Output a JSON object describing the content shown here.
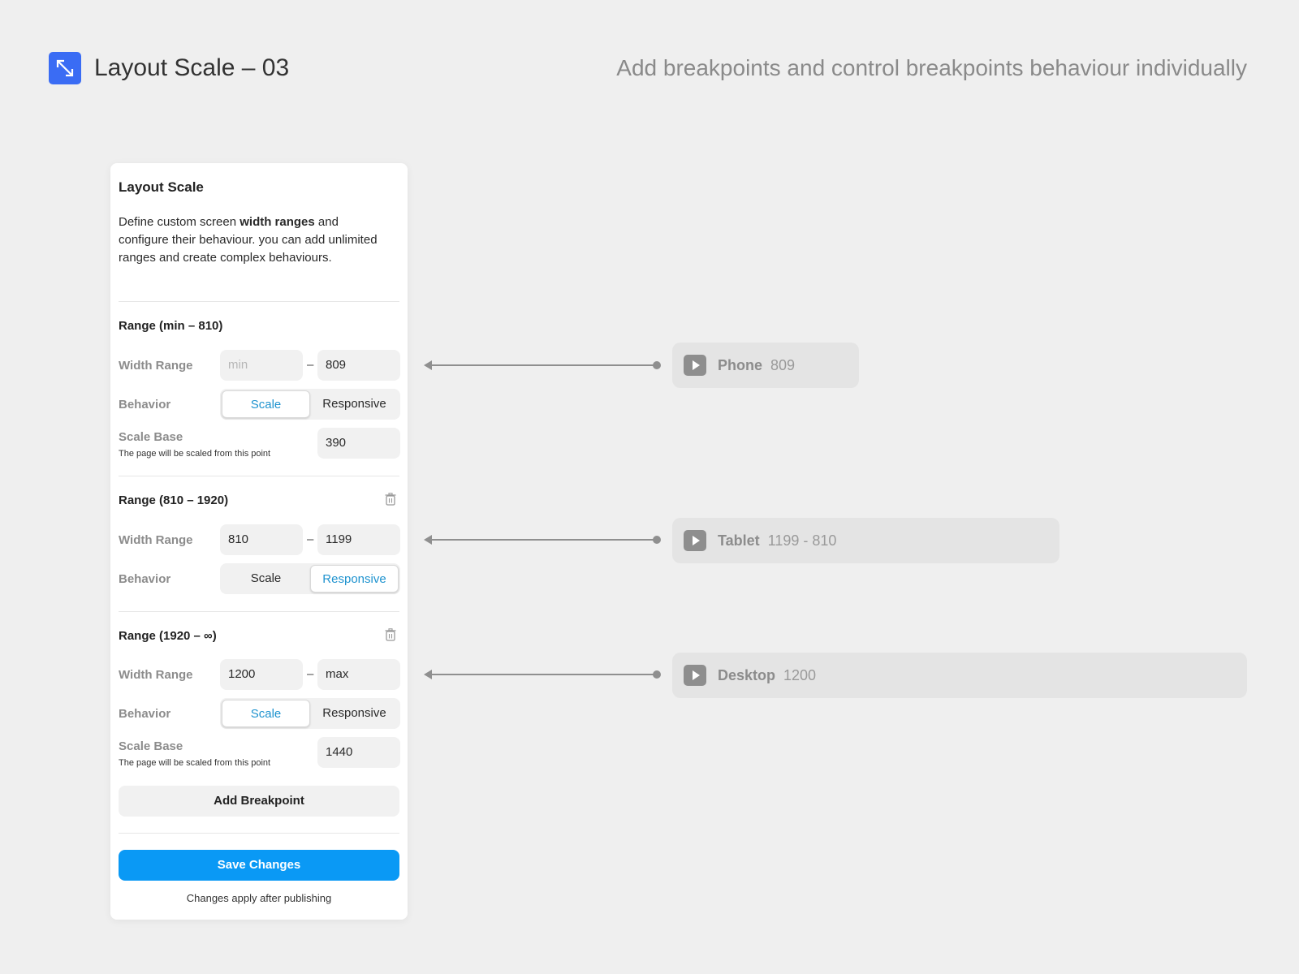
{
  "header": {
    "title": "Layout Scale – 03",
    "subtitle": "Add breakpoints and control breakpoints behaviour individually",
    "logo_icon": "diagonal-resize-arrow-icon",
    "accent_color": "#3a6cf4"
  },
  "panel": {
    "title": "Layout Scale",
    "desc_part1": "Define custom screen ",
    "desc_bold": "width ranges",
    "desc_part2": "  and configure their behaviour. you can add unlimited ranges and create complex behaviours.",
    "width_range_label": "Width Range",
    "behavior_label": "Behavior",
    "scale_base_label": "Scale Base",
    "scale_base_note": "The page will be scaled from this point",
    "range_dash": "–",
    "behavior_options": [
      "Scale",
      "Responsive"
    ],
    "ranges": [
      {
        "title": "Range (min – 810)",
        "min": "",
        "min_placeholder": "min",
        "max": "809",
        "behavior": "Scale",
        "scale_base": "390",
        "deletable": false
      },
      {
        "title": "Range  (810 – 1920)",
        "min": "810",
        "max": "1199",
        "behavior": "Responsive",
        "deletable": true
      },
      {
        "title": "Range (1920 – ∞)",
        "min": "1200",
        "max": "max",
        "behavior": "Scale",
        "scale_base": "1440",
        "deletable": true
      }
    ],
    "add_breakpoint_label": "Add Breakpoint",
    "save_label": "Save Changes",
    "save_color": "#0a99f5",
    "footnote": "Changes apply after publishing"
  },
  "devices": [
    {
      "name": "Phone",
      "range": "809",
      "icon": "play-icon"
    },
    {
      "name": "Tablet",
      "range": "1199 - 810",
      "icon": "play-icon"
    },
    {
      "name": "Desktop",
      "range": "1200",
      "icon": "play-icon"
    }
  ]
}
